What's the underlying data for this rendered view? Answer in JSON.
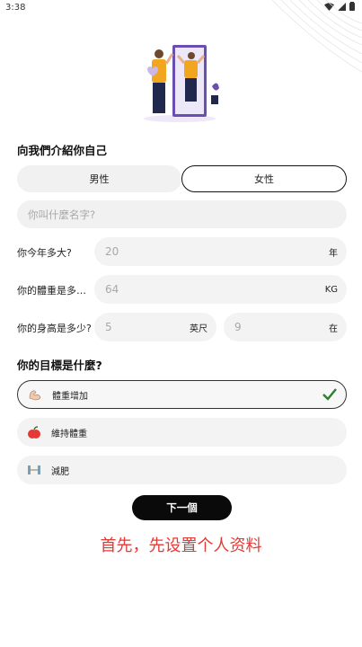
{
  "status_bar": {
    "time": "3:38"
  },
  "headings": {
    "intro": "向我們介紹你自己",
    "goal": "你的目標是什麼?"
  },
  "gender": {
    "male": "男性",
    "female": "女性",
    "selected": "female"
  },
  "name": {
    "placeholder": "你叫什麼名字?",
    "value": ""
  },
  "age": {
    "label": "你今年多大?",
    "value": "20",
    "unit": "年"
  },
  "weight": {
    "label": "你的體重是多少...",
    "value": "64",
    "unit": "KG"
  },
  "height": {
    "label": "你的身高是多少?",
    "feet": "5",
    "feet_unit": "英尺",
    "inches": "9",
    "inches_unit": "在"
  },
  "goals": [
    {
      "label": "體重增加",
      "icon": "arm-flex-icon",
      "selected": true
    },
    {
      "label": "維持體重",
      "icon": "apple-icon",
      "selected": false
    },
    {
      "label": "減肥",
      "icon": "dumbbell-icon",
      "selected": false
    }
  ],
  "next_button": "下一個",
  "caption": "首先，先设置个人资料",
  "colors": {
    "accent": "#111111",
    "check": "#2e7d32",
    "caption": "#e53935"
  }
}
